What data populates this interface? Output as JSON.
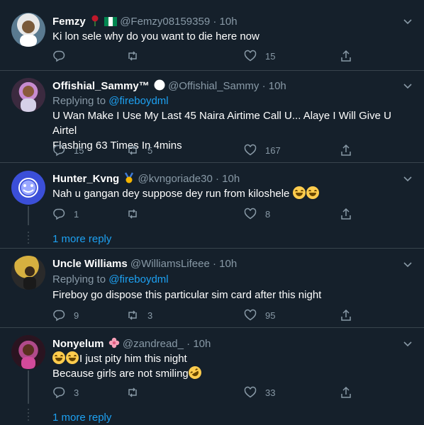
{
  "tweets": [
    {
      "name": "Femzy",
      "handle": "@Femzy08159359",
      "dot": "·",
      "time": "10h",
      "reply_to_prefix": "",
      "reply_to_mention": "",
      "text": "Ki lon sele why do you want to die here now",
      "replies": "",
      "retweets": "",
      "likes": "15",
      "avatar_colors": [
        "#e8e8e8",
        "#5a7a90"
      ]
    },
    {
      "name": "Offishial_Sammy™",
      "handle": "@Offishial_Sammy",
      "dot": "·",
      "time": "10h",
      "reply_to_prefix": "Replying to ",
      "reply_to_mention": "@fireboydml",
      "text_line1": "U Wan Make I Use My Last 45 Naira Airtime Call U... Alaye I Will Give U Airtel",
      "text_line2": "Flashing 63 Times In 4mins",
      "replies": "15",
      "retweets": "5",
      "likes": "167",
      "avatar_colors": [
        "#c78bd0",
        "#3b2a3f"
      ]
    },
    {
      "name": "Hunter_Kvng",
      "handle": "@kvngoriade30",
      "dot": "·",
      "time": "10h",
      "text": "Nah u gangan dey suppose dey run from kiloshele",
      "replies": "1",
      "retweets": "",
      "likes": "8",
      "more_reply": "1 more reply",
      "avatar_colors": [
        "#3b4fd8",
        "#9aa8ff"
      ]
    },
    {
      "name": "Uncle Williams",
      "handle": "@WilliamsLifeee",
      "dot": "·",
      "time": "10h",
      "reply_to_prefix": "Replying to ",
      "reply_to_mention": "@fireboydml",
      "text": "Fireboy go dispose this particular sim card after this night",
      "replies": "9",
      "retweets": "3",
      "likes": "95",
      "avatar_colors": [
        "#d6b040",
        "#2a2a2a"
      ]
    },
    {
      "name": "Nonyelum",
      "handle": "@zandread_",
      "dot": "·",
      "time": "10h",
      "text_line1": "I just pity him this night",
      "text_line2": "Because girls are not smiling",
      "replies": "3",
      "retweets": "",
      "likes": "33",
      "more_reply": "1 more reply",
      "avatar_colors": [
        "#b04a8a",
        "#2a1420"
      ]
    }
  ],
  "colors": {
    "background": "#15202b",
    "secondary_text": "#8899a6",
    "accent": "#1da1f2",
    "divider": "#38444d"
  },
  "icons": [
    "reply-icon",
    "retweet-icon",
    "like-icon",
    "share-icon",
    "chevron-down-icon"
  ]
}
